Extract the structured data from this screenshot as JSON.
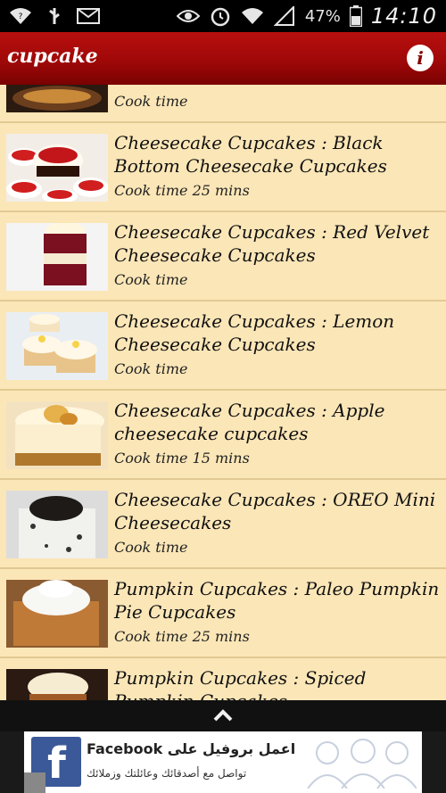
{
  "status_bar": {
    "battery": "47%",
    "time": "14:10"
  },
  "app_bar": {
    "title": "cupcake"
  },
  "items": [
    {
      "title": "",
      "cook_time": "Cook time",
      "thumb": "cheesecake-slice"
    },
    {
      "title": "Cheesecake Cupcakes : Black Bottom Cheesecake Cupcakes",
      "cook_time": "Cook time 25 mins",
      "thumb": "black-bottom-cupcakes"
    },
    {
      "title": "Cheesecake Cupcakes : Red Velvet Cheesecake Cupcakes",
      "cook_time": "Cook time",
      "thumb": "red-velvet-cupcake"
    },
    {
      "title": "Cheesecake Cupcakes : Lemon Cheesecake Cupcakes",
      "cook_time": "Cook time",
      "thumb": "lemon-cupcakes"
    },
    {
      "title": "Cheesecake Cupcakes : Apple cheesecake cupcakes",
      "cook_time": "Cook time 15 mins",
      "thumb": "apple-cupcakes"
    },
    {
      "title": "Cheesecake Cupcakes : OREO Mini Cheesecakes",
      "cook_time": "Cook time",
      "thumb": "oreo-cheesecakes"
    },
    {
      "title": "Pumpkin Cupcakes : Paleo Pumpkin Pie Cupcakes",
      "cook_time": "Cook time 25 mins",
      "thumb": "pumpkin-pie-cupcake"
    },
    {
      "title": "Pumpkin Cupcakes : Spiced Pumpkin Cupcakes",
      "cook_time": "",
      "thumb": "spiced-pumpkin-cupcake"
    }
  ],
  "ad": {
    "title": "اعمل بروفيل على Facebook",
    "subtitle": "تواصل مع أصدقائك وعائلتك وزملائك",
    "logo_letter": "f",
    "brand_color": "#3b5998"
  },
  "colors": {
    "app_bar": "#a00808",
    "list_bg": "#fbe6b7",
    "divider": "#e2c993"
  }
}
